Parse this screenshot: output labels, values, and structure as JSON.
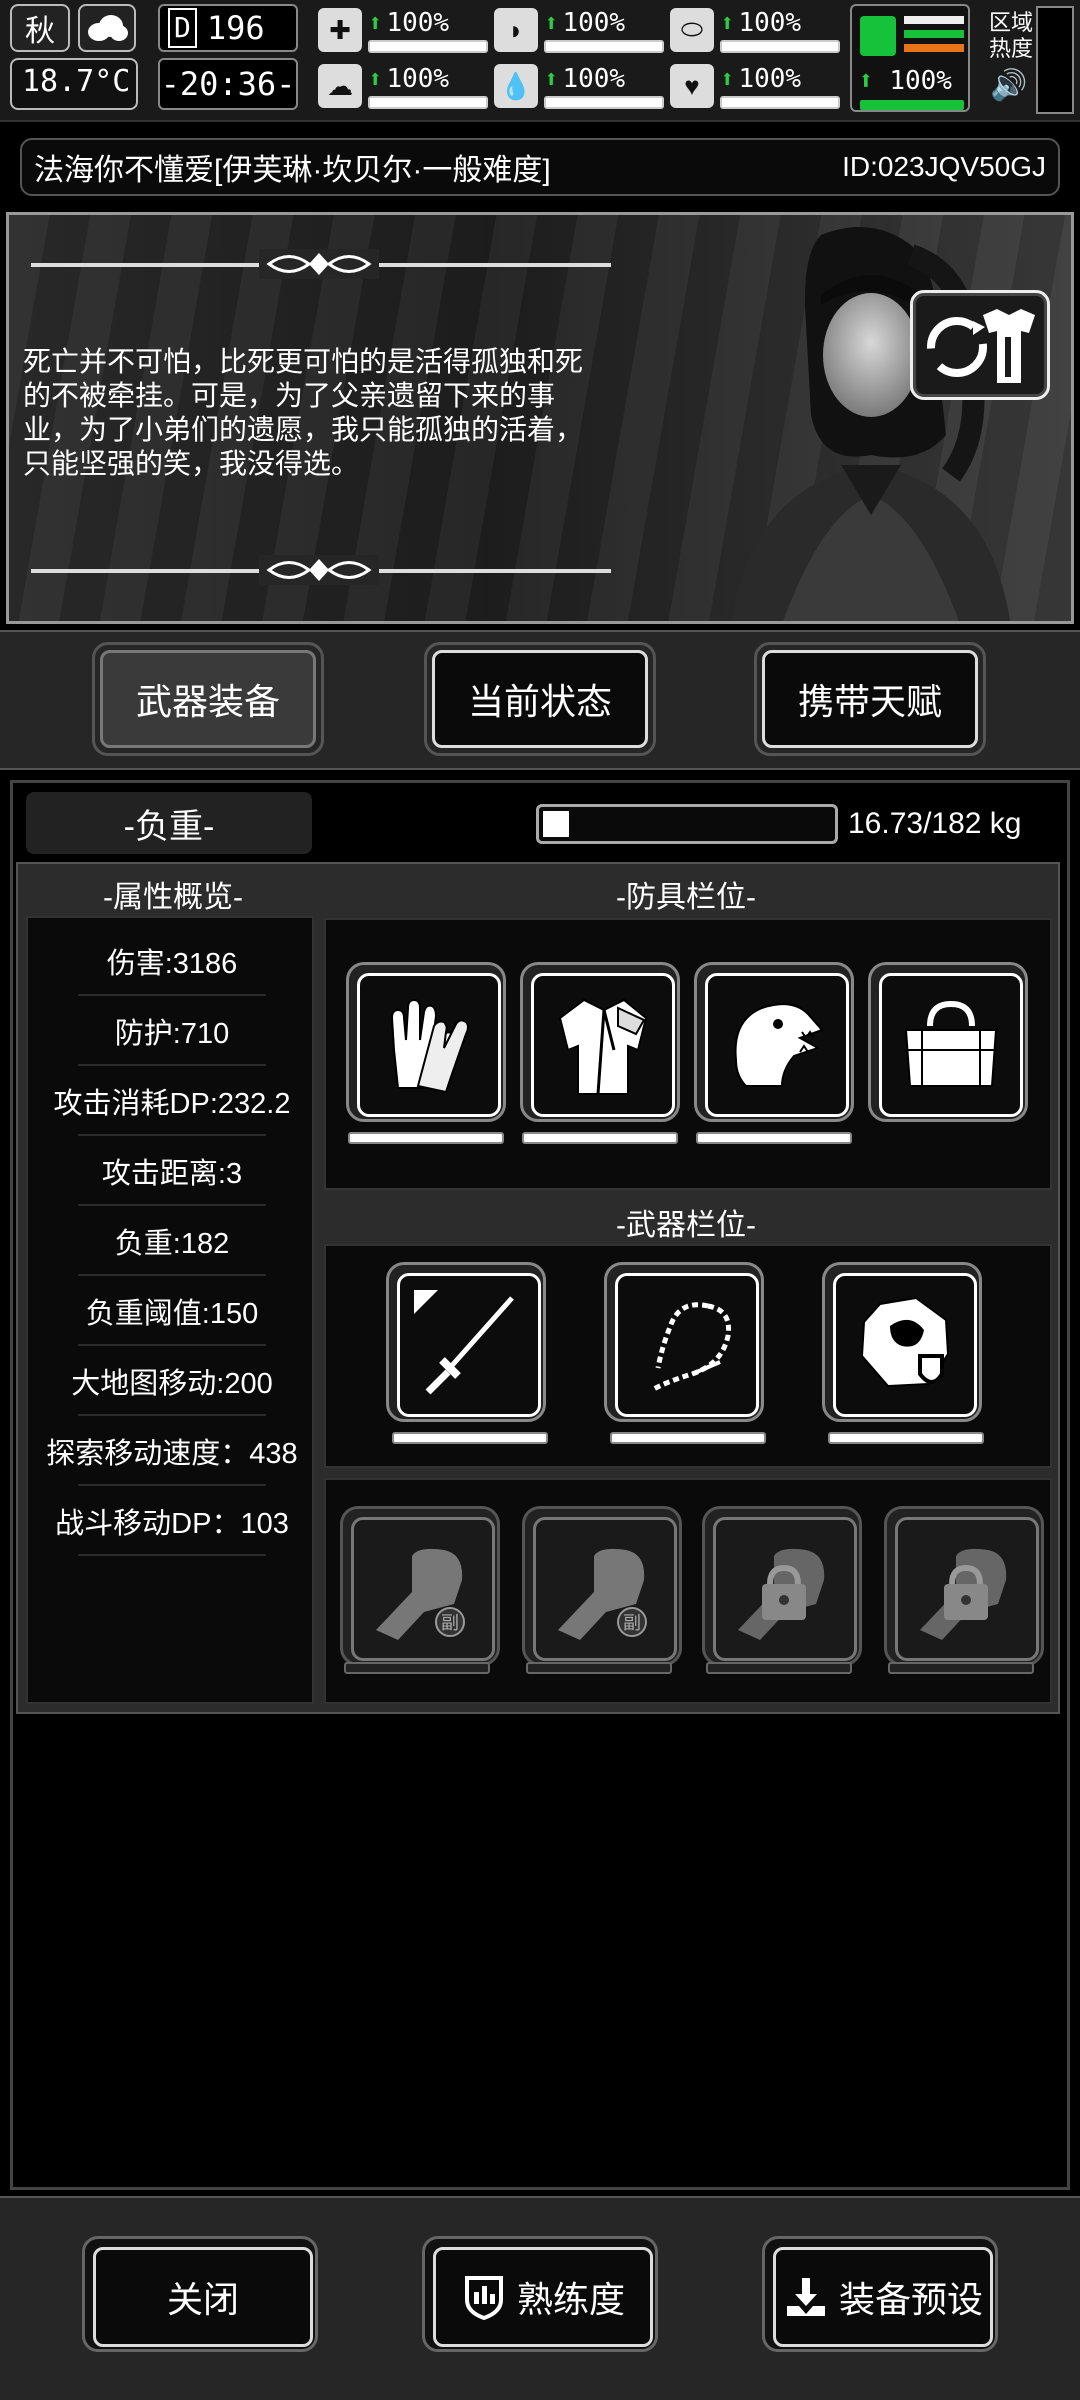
{
  "status": {
    "season": "秋",
    "temperature": "18.7°C",
    "day": "196",
    "day_icon": "D",
    "clock": "-20:36-",
    "stats": [
      {
        "icon": "medkit-icon",
        "value": "100%"
      },
      {
        "icon": "stomach-icon",
        "value": "100%"
      },
      {
        "icon": "pill-icon",
        "value": "100%"
      },
      {
        "icon": "brain-icon",
        "value": "100%"
      },
      {
        "icon": "water-drop-icon",
        "value": "100%"
      },
      {
        "icon": "heart-icon",
        "value": "100%"
      }
    ],
    "leg_value": "100%",
    "region_label_1": "区域",
    "region_label_2": "热度"
  },
  "title": {
    "name": "法海你不懂爱[伊芙琳·坎贝尔·一般难度]",
    "id": "ID:023JQV50GJ"
  },
  "story": {
    "quote": "死亡并不可怕，比死更可怕的是活得孤独和死的不被牵挂。可是，为了父亲遗留下来的事业，为了小弟们的遗愿，我只能孤独的活着，只能坚强的笑，我没得选。"
  },
  "tabs": [
    {
      "label": "武器装备",
      "active": true
    },
    {
      "label": "当前状态",
      "active": false
    },
    {
      "label": "携带天赋",
      "active": false
    }
  ],
  "load": {
    "label": "-负重-",
    "text": "16.73/182 kg",
    "fraction": 0.092
  },
  "attributes": {
    "header": "-属性概览-",
    "items": [
      "伤害:3186",
      "防护:710",
      "攻击消耗DP:232.2",
      "攻击距离:3",
      "负重:182",
      "负重阈值:150",
      "大地图移动:200",
      "探索移动速度：438",
      "战斗移动DP：103"
    ]
  },
  "armor": {
    "header": "-防具栏位-",
    "slots": [
      "gloves-icon",
      "coat-icon",
      "dinosaur-mask-icon",
      "duffel-bag-icon"
    ]
  },
  "weapons": {
    "header": "-武器栏位-",
    "slots": [
      "katana-icon",
      "chain-whip-icon",
      "shield-emblem-icon"
    ],
    "extra_slots": [
      {
        "icon": "fist-icon",
        "badge": "副"
      },
      {
        "icon": "fist-icon",
        "badge": "副"
      },
      {
        "icon": "fist-locked-icon",
        "badge": ""
      },
      {
        "icon": "fist-locked-icon",
        "badge": ""
      }
    ]
  },
  "buttons": {
    "close": "关闭",
    "proficiency": "熟练度",
    "preset": "装备预设"
  }
}
